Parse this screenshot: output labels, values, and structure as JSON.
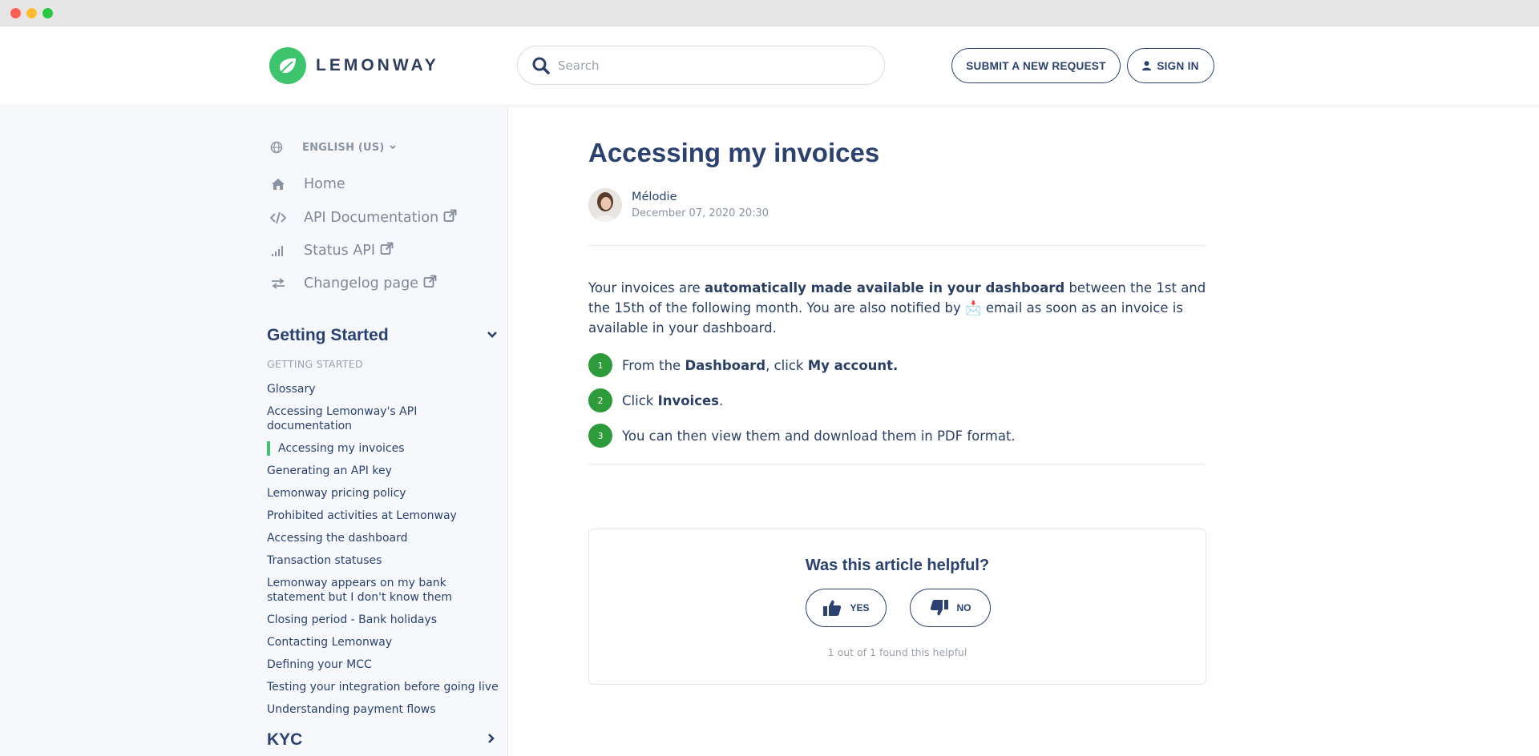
{
  "header": {
    "logo_text": "LEMONWAY",
    "search_placeholder": "Search",
    "submit_label": "SUBMIT A NEW REQUEST",
    "signin_label": "SIGN IN"
  },
  "sidebar": {
    "language": "ENGLISH (US)",
    "nav": [
      {
        "label": "Home",
        "icon": "home-icon"
      },
      {
        "label": "API Documentation",
        "icon": "code-icon"
      },
      {
        "label": "Status API",
        "icon": "signal-icon"
      },
      {
        "label": "Changelog page",
        "icon": "exchange-icon"
      }
    ],
    "section": {
      "title": "Getting Started",
      "subtitle": "GETTING STARTED",
      "articles": [
        "Glossary",
        "Accessing Lemonway's API documentation",
        "Accessing my invoices",
        "Generating an API key",
        "Lemonway pricing policy",
        "Prohibited activities at Lemonway",
        "Accessing the dashboard",
        "Transaction statuses",
        "Lemonway appears on my bank statement but I don't know them",
        "Closing period - Bank holidays",
        "Contacting Lemonway",
        "Defining your MCC",
        "Testing your integration before going live",
        "Understanding payment flows"
      ],
      "active_index": 2
    },
    "next_section": "KYC"
  },
  "article": {
    "title": "Accessing my invoices",
    "author": "Mélodie",
    "date": "December 07, 2020 20:30",
    "intro_1": "Your invoices are ",
    "intro_bold": "automatically made available in your dashboard",
    "intro_2": " between the 1st and the 15th of the following month. You are also notified by ",
    "intro_emoji": "📩",
    "intro_3": " email as soon as an invoice is available in your dashboard.",
    "steps": [
      {
        "num": "1",
        "pre": "From the ",
        "b1": "Dashboard",
        "mid": ", click ",
        "b2": "My account.",
        "post": ""
      },
      {
        "num": "2",
        "pre": "Click ",
        "b1": "Invoices",
        "mid": ".",
        "b2": "",
        "post": ""
      },
      {
        "num": "3",
        "pre": "You can then view them and download them in PDF format.",
        "b1": "",
        "mid": "",
        "b2": "",
        "post": ""
      }
    ]
  },
  "feedback": {
    "question": "Was this article helpful?",
    "yes_label": "YES",
    "no_label": "NO",
    "count_text": "1 out of 1 found this helpful"
  },
  "colors": {
    "brand_green": "#3ec46d",
    "step_green": "#2e9b3b",
    "navy": "#2b4170"
  }
}
